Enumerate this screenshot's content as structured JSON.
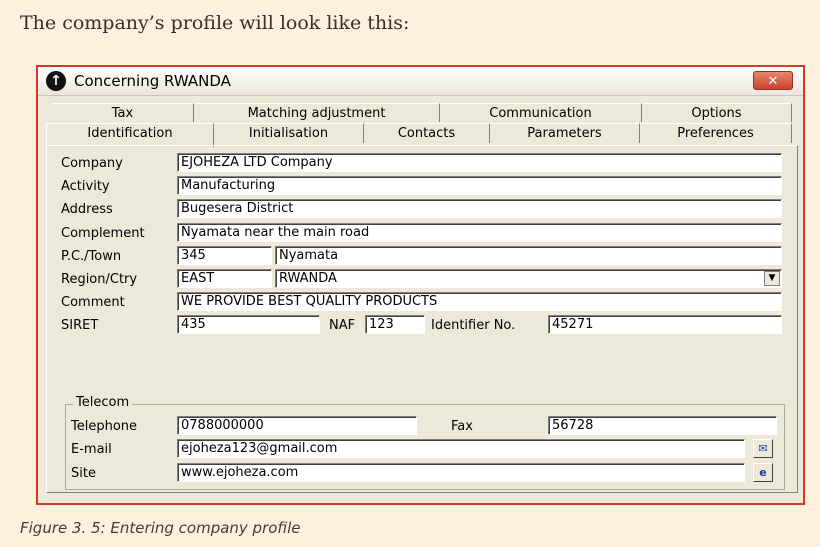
{
  "intro_text": "The company’s profile will look like this:",
  "caption": "Figure 3. 5: Entering company profile",
  "window": {
    "title": "Concerning RWANDA",
    "close_label": "✕"
  },
  "tabs_row1": [
    "Tax",
    "Matching adjustment",
    "Communication",
    "Options"
  ],
  "tabs_row2": [
    "Identification",
    "Initialisation",
    "Contacts",
    "Parameters",
    "Preferences"
  ],
  "form": {
    "company": {
      "label": "Company",
      "value": "EJOHEZA LTD Company"
    },
    "activity": {
      "label": "Activity",
      "value": "Manufacturing"
    },
    "address": {
      "label": "Address",
      "value": "Bugesera District"
    },
    "complement": {
      "label": "Complement",
      "value": "Nyamata near the main road"
    },
    "pc_town": {
      "label": "P.C./Town",
      "pc": "345",
      "town": "Nyamata"
    },
    "region_ctry": {
      "label": "Region/Ctry",
      "region": "EAST",
      "country": "RWANDA"
    },
    "comment": {
      "label": "Comment",
      "value": "WE PROVIDE BEST QUALITY PRODUCTS"
    },
    "siret": {
      "label": "SIRET",
      "value": "435",
      "naf_label": "NAF",
      "naf": "123",
      "identifier_label": "Identifier No.",
      "identifier": "45271"
    }
  },
  "telecom": {
    "group_label": "Telecom",
    "telephone": {
      "label": "Telephone",
      "value": "0788000000"
    },
    "fax": {
      "label": "Fax",
      "value": "56728"
    },
    "email": {
      "label": "E-mail",
      "value": "ejoheza123@gmail.com"
    },
    "site": {
      "label": "Site",
      "value": "www.ejoheza.com"
    }
  },
  "colors": {
    "window_border": "#d33a2a",
    "background": "#fdf0dd",
    "dialog": "#ece9d8"
  }
}
